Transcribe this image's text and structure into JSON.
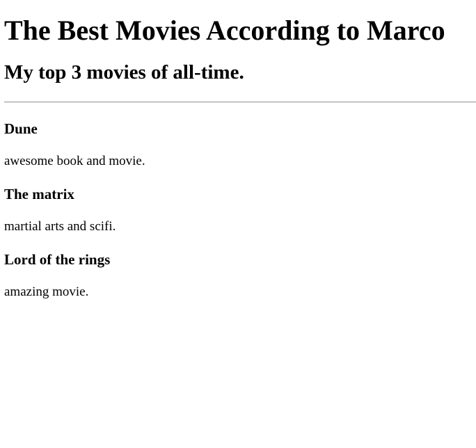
{
  "page": {
    "title": "The Best Movies According to Marco",
    "subtitle": "My top 3 movies of all-time."
  },
  "movies": [
    {
      "title": "Dune",
      "description": "awesome book and movie."
    },
    {
      "title": "The matrix",
      "description": "martial arts and scifi."
    },
    {
      "title": "Lord of the rings",
      "description": "amazing movie."
    }
  ]
}
